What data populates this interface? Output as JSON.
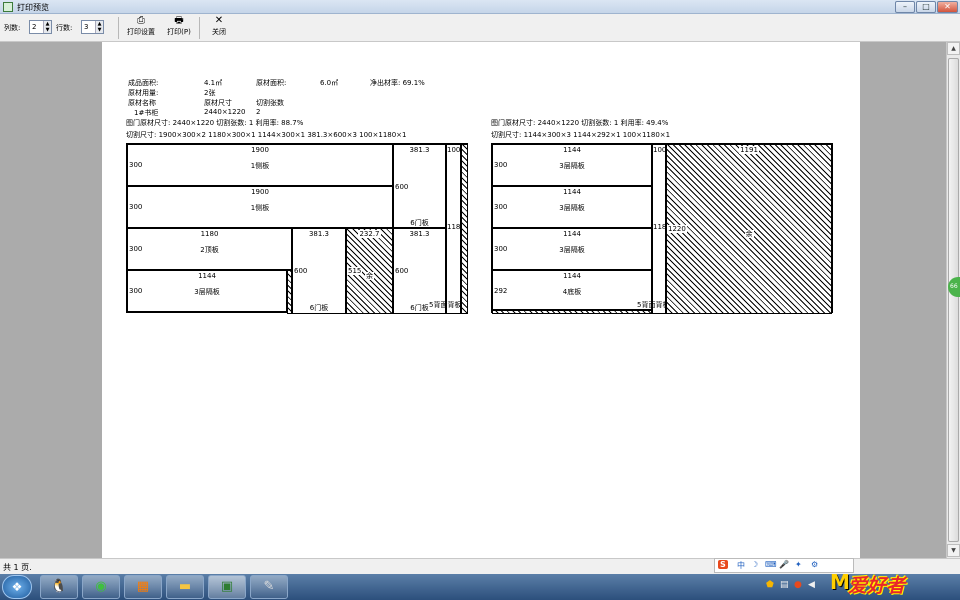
{
  "window": {
    "title": "打印预览",
    "min": "–",
    "max": "□",
    "close": "✕"
  },
  "toolbar": {
    "cols_label": "列数:",
    "cols_value": "2",
    "rows_label": "行数:",
    "rows_value": "3",
    "print_setup": "打印设置",
    "print": "打印(P)",
    "close": "关闭"
  },
  "summary": {
    "product_area_label": "成品面积:",
    "product_area": "4.1㎡",
    "raw_area_label": "原材面积:",
    "raw_area": "6.0㎡",
    "net_rate_label": "净出材率: 69.1%",
    "raw_usage_label": "原材用量:",
    "raw_usage": "2张",
    "col_name": "原材名称",
    "col_size": "原材尺寸",
    "col_cuts": "切割张数",
    "row_name": "1#书柜",
    "row_size": "2440×1220",
    "row_cuts": "2"
  },
  "sheets": [
    {
      "header": "图门原材尺寸: 2440×1220  切割张数: 1  利用率: 88.7%",
      "cuts": "切割尺寸: 1900×300×2  1180×300×1  1144×300×1  381.3×600×3  100×1180×1",
      "pieces": [
        {
          "w": "1900",
          "h": "300",
          "name": "1侧板"
        },
        {
          "w": "1900",
          "h": "300",
          "name": "1侧板"
        },
        {
          "w": "1180",
          "h": "300",
          "name": "2顶板"
        },
        {
          "w": "1144",
          "h": "300",
          "name": "3层隔板"
        },
        {
          "w": "381.3",
          "h": "600",
          "name": "6门板"
        },
        {
          "w": "381.3",
          "h": "600",
          "name": "6门板"
        },
        {
          "w": "381.3",
          "h": "600",
          "name": "6门板"
        },
        {
          "w": "100",
          "h": "1180",
          "name": "5背面背板"
        },
        {
          "w": "232.7",
          "h": "515",
          "name": "余"
        }
      ]
    },
    {
      "header": "图门原材尺寸: 2440×1220  切割张数: 1  利用率: 49.4%",
      "cuts": "切割尺寸: 1144×300×3  1144×292×1  100×1180×1",
      "pieces": [
        {
          "w": "1144",
          "h": "300",
          "name": "3层隔板"
        },
        {
          "w": "1144",
          "h": "300",
          "name": "3层隔板"
        },
        {
          "w": "1144",
          "h": "300",
          "name": "3层隔板"
        },
        {
          "w": "1144",
          "h": "292",
          "name": "4底板"
        },
        {
          "w": "100",
          "h": "1180",
          "name": "5背面背板"
        },
        {
          "w": "1191",
          "h": "1220",
          "name": "余"
        }
      ]
    }
  ],
  "status": {
    "pages": "共 1 页."
  },
  "taskbar": {
    "logo": "爱好者"
  },
  "ime": {
    "s": "S",
    "zh": "中"
  }
}
